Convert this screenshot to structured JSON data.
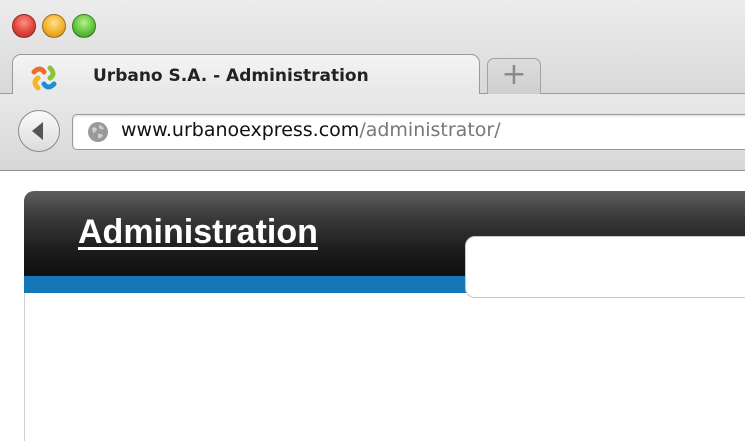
{
  "browser": {
    "tab": {
      "title": "Urbano S.A. - Administration",
      "favicon": "joomla-icon"
    },
    "new_tab_label": "+",
    "address": {
      "scheme": "",
      "domain": "www.urbanoexpress.com",
      "path": "/administrator/"
    },
    "icons": {
      "back": "back-arrow-icon",
      "site": "globe-icon"
    },
    "colors": {
      "close": "#e0443a",
      "minimize": "#f2b12a",
      "maximize": "#5fc33b"
    }
  },
  "page": {
    "header_link": "Administration",
    "colors": {
      "header": "#1c1c1c",
      "accent_band": "#1577b7"
    }
  }
}
